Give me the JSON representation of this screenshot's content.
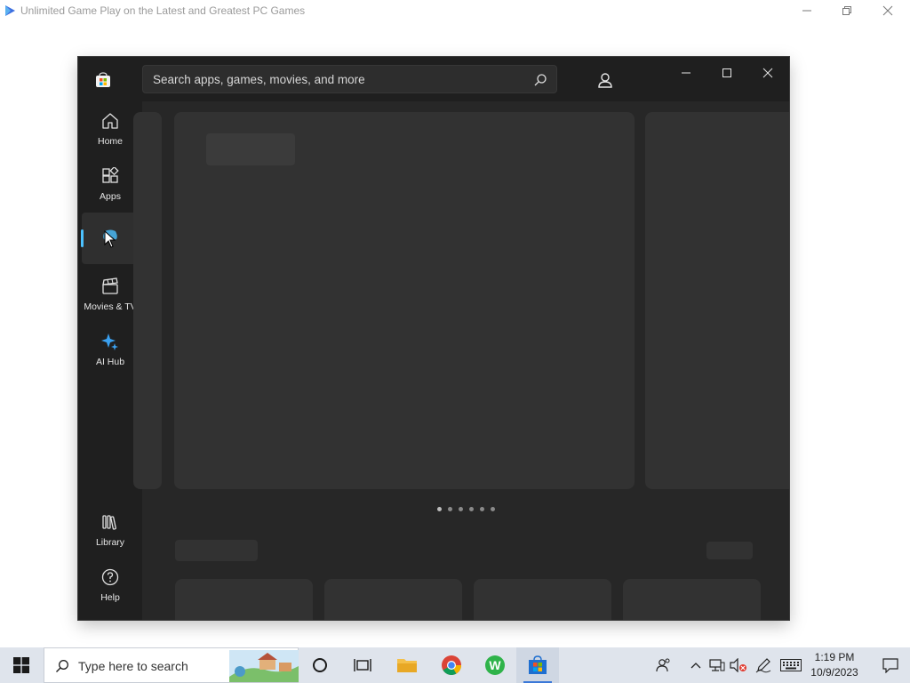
{
  "outer_window": {
    "title": "Unlimited Game Play on the Latest and Greatest PC Games",
    "logo_icon": "play-triangle-icon",
    "controls": [
      "minimize-icon",
      "restore-icon",
      "close-icon"
    ]
  },
  "store": {
    "logo_icon": "store-bag-icon",
    "search": {
      "placeholder": "Search apps, games, movies, and more",
      "icon": "search-icon"
    },
    "account_icon": "person-icon",
    "controls": [
      "minimize-icon",
      "maximize-icon",
      "close-icon"
    ],
    "accent_color": "#4cc2ff",
    "nav": {
      "home": {
        "label": "Home",
        "icon": "home-icon"
      },
      "apps": {
        "label": "Apps",
        "icon": "apps-icon"
      },
      "gaming": {
        "label": "",
        "icon": "gamepad-icon",
        "active": true
      },
      "movies": {
        "label": "Movies & TV",
        "icon": "clapperboard-icon"
      },
      "ai_hub": {
        "label": "AI Hub",
        "icon": "sparkle-icon"
      },
      "library": {
        "label": "Library",
        "icon": "library-icon"
      },
      "help": {
        "label": "Help",
        "icon": "help-icon"
      }
    },
    "carousel": {
      "dot_count": 6,
      "active_index": 0
    }
  },
  "taskbar": {
    "start_icon": "windows-icon",
    "search_placeholder": "Type here to search",
    "pinned": [
      "cortana-icon",
      "task-view-icon",
      "file-explorer-icon",
      "chrome-icon",
      "wps-icon",
      "ms-store-icon"
    ],
    "tray_icons": [
      "people-icon",
      "chevron-up-icon",
      "network-icon",
      "volume-muted-icon",
      "pen-icon",
      "keyboard-icon"
    ],
    "time": "1:19 PM",
    "date": "10/9/2023",
    "notification_icon": "notification-icon"
  }
}
